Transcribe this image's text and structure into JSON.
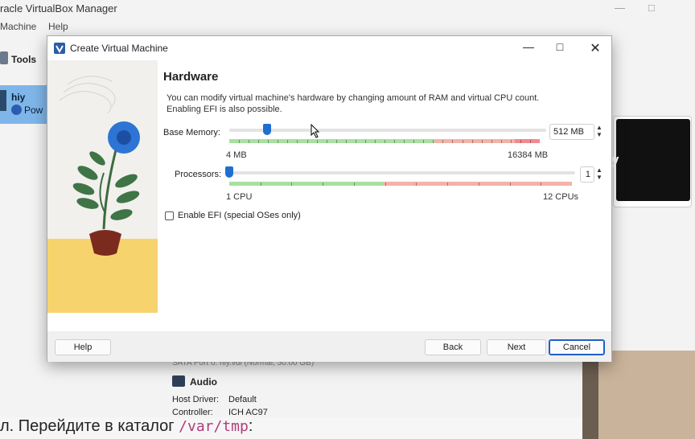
{
  "background_window": {
    "title": "racle VirtualBox Manager",
    "menu": [
      "Machine",
      "Help"
    ],
    "tools_label": "Tools",
    "vm_name": "hiy",
    "vm_state": "Pow",
    "preview_text": "y",
    "storage_row": "SATA Port 0:              hiy.vdi (Normal, 50.00 GB)",
    "audio_title": "Audio",
    "host_driver_label": "Host Driver:",
    "host_driver_value": "Default",
    "controller_label": "Controller:",
    "controller_value": "ICH AC97"
  },
  "bottom_text": {
    "prefix": "л. Перейдите в каталог ",
    "code": "/var/tmp",
    "suffix": ":"
  },
  "dialog": {
    "title": "Create Virtual Machine",
    "heading": "Hardware",
    "description": "You can modify virtual machine's hardware by changing amount of RAM and virtual CPU count. Enabling EFI is also possible.",
    "base_memory": {
      "label": "Base Memory:",
      "value": "512 MB",
      "min_label": "4 MB",
      "max_label": "16384 MB",
      "min": 4,
      "max": 16384,
      "current": 512
    },
    "processors": {
      "label": "Processors:",
      "value": "1",
      "min_label": "1 CPU",
      "max_label": "12 CPUs",
      "min": 1,
      "max": 12,
      "current": 1
    },
    "efi_label": "Enable EFI (special OSes only)",
    "efi_checked": false,
    "buttons": {
      "help": "Help",
      "back": "Back",
      "next": "Next",
      "cancel": "Cancel"
    }
  },
  "colors": {
    "slider_thumb": "#1f6fd1",
    "scale_green": "#a8e0a0",
    "scale_red": "#f2b3a8",
    "vm_selected_bg": "#7fb6ea"
  }
}
